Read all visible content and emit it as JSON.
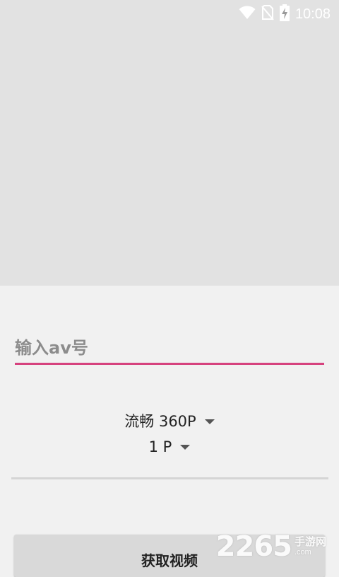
{
  "status_bar": {
    "time": "10:08",
    "icons": [
      "wifi-icon",
      "no-sim-icon",
      "battery-charging-icon"
    ]
  },
  "form": {
    "av_input": {
      "placeholder": "输入av号",
      "value": ""
    },
    "quality_spinner": {
      "selected": "流畅 360P"
    },
    "part_spinner": {
      "selected": "1 P"
    },
    "get_video_button": {
      "label": "获取视频"
    }
  },
  "watermark": {
    "number": "2265",
    "cn_text": "手游网",
    "domain": ".com"
  },
  "colors": {
    "accent": "#d6427e",
    "preview_background": "#e2e2e2",
    "page_background": "#f1f1f1",
    "button_background": "#d9d9d9"
  }
}
